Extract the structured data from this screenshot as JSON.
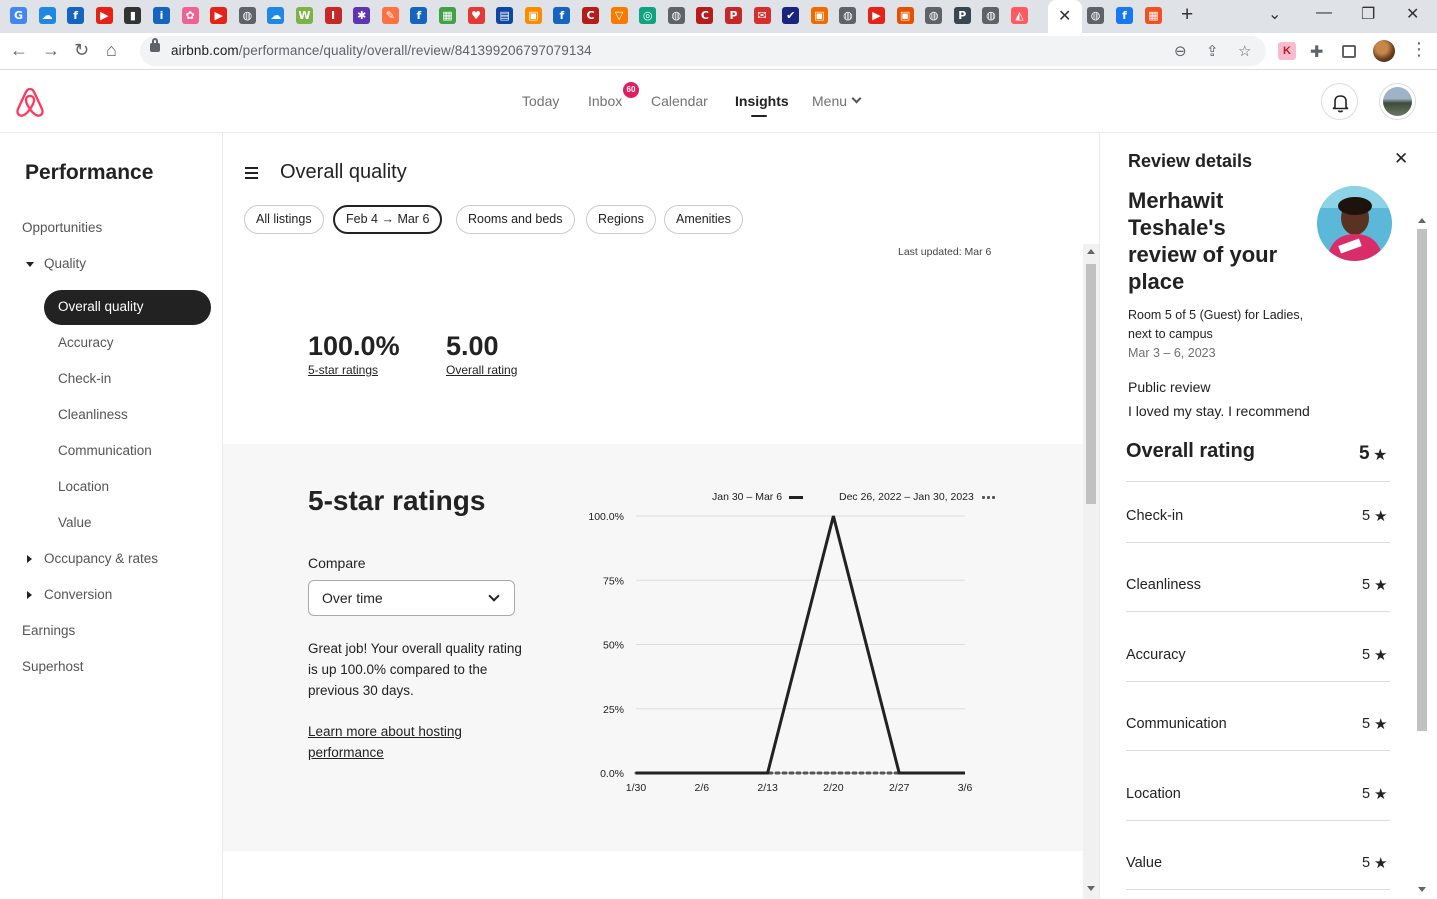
{
  "browser": {
    "tab_icons": [
      {
        "name": "google-icon",
        "color": "#4285f4",
        "glyph": "G"
      },
      {
        "name": "cloud-icon",
        "color": "#1e88e5",
        "glyph": "☁"
      },
      {
        "name": "info-icon",
        "color": "#1565c0",
        "glyph": "f"
      },
      {
        "name": "youtube-icon",
        "color": "#e62117",
        "glyph": "▶"
      },
      {
        "name": "app-icon",
        "color": "#333333",
        "glyph": "▮"
      },
      {
        "name": "info-box-icon",
        "color": "#1565c0",
        "glyph": "i"
      },
      {
        "name": "flower-icon",
        "color": "#f06292",
        "glyph": "✿"
      },
      {
        "name": "youtube-icon",
        "color": "#e62117",
        "glyph": "▶"
      },
      {
        "name": "globe-icon",
        "color": "#5f6368",
        "glyph": "◍"
      },
      {
        "name": "cloud-icon",
        "color": "#1e88e5",
        "glyph": "☁"
      },
      {
        "name": "w-icon",
        "color": "#7cb342",
        "glyph": "W"
      },
      {
        "name": "i-red-icon",
        "color": "#c62828",
        "glyph": "I"
      },
      {
        "name": "asterisk-icon",
        "color": "#5e35b1",
        "glyph": "✱"
      },
      {
        "name": "pen-icon",
        "color": "#ff7043",
        "glyph": "✎"
      },
      {
        "name": "info-icon",
        "color": "#1565c0",
        "glyph": "f"
      },
      {
        "name": "windows-icon",
        "color": "#43a047",
        "glyph": "▦"
      },
      {
        "name": "heart-icon",
        "color": "#e53935",
        "glyph": "♥"
      },
      {
        "name": "news-icon",
        "color": "#0d47a1",
        "glyph": "▤"
      },
      {
        "name": "box-icon",
        "color": "#fb8c00",
        "glyph": "▣"
      },
      {
        "name": "info-icon",
        "color": "#1565c0",
        "glyph": "f"
      },
      {
        "name": "c-icon",
        "color": "#b71c1c",
        "glyph": "C"
      },
      {
        "name": "funnel-icon",
        "color": "#f57c00",
        "glyph": "▽"
      },
      {
        "name": "chatgpt-icon",
        "color": "#10a37f",
        "glyph": "◎"
      },
      {
        "name": "globe-icon",
        "color": "#5f6368",
        "glyph": "◍"
      },
      {
        "name": "c-icon",
        "color": "#b71c1c",
        "glyph": "C"
      },
      {
        "name": "pd-icon",
        "color": "#c62828",
        "glyph": "P"
      },
      {
        "name": "mail-icon",
        "color": "#d32f2f",
        "glyph": "✉"
      },
      {
        "name": "check-icon",
        "color": "#1a237e",
        "glyph": "✔"
      },
      {
        "name": "box-icon",
        "color": "#ef6c00",
        "glyph": "▣"
      },
      {
        "name": "globe-icon",
        "color": "#5f6368",
        "glyph": "◍"
      },
      {
        "name": "youtube-icon",
        "color": "#e62117",
        "glyph": "▶"
      },
      {
        "name": "box-icon",
        "color": "#e65100",
        "glyph": "▣"
      },
      {
        "name": "globe-icon",
        "color": "#5f6368",
        "glyph": "◍"
      },
      {
        "name": "p-icon",
        "color": "#37474f",
        "glyph": "P"
      },
      {
        "name": "globe-icon",
        "color": "#5f6368",
        "glyph": "◍"
      },
      {
        "name": "airbnb-icon",
        "color": "#ff5a5f",
        "glyph": "◭"
      }
    ],
    "tab_icons_after": [
      {
        "name": "globe-icon",
        "color": "#5f6368",
        "glyph": "◍"
      },
      {
        "name": "facebook-icon",
        "color": "#1877f2",
        "glyph": "f"
      },
      {
        "name": "windows-icon",
        "color": "#f25022",
        "glyph": "▦"
      }
    ],
    "url_host": "airbnb.com",
    "url_path": "/performance/quality/overall/review/841399206797079134"
  },
  "header": {
    "nav": [
      "Today",
      "Inbox",
      "Calendar",
      "Insights",
      "Menu"
    ],
    "inbox_badge": "60",
    "active_nav": "Insights"
  },
  "sidebar": {
    "title": "Performance",
    "items": {
      "opportunities": "Opportunities",
      "quality": "Quality",
      "overall": "Overall quality",
      "accuracy": "Accuracy",
      "checkin": "Check-in",
      "cleanliness": "Cleanliness",
      "communication": "Communication",
      "location": "Location",
      "value": "Value",
      "occupancy": "Occupancy & rates",
      "conversion": "Conversion",
      "earnings": "Earnings",
      "superhost": "Superhost"
    }
  },
  "main": {
    "title": "Overall quality",
    "filters": {
      "all": "All listings",
      "date_from": "Feb 4",
      "date_to": "Mar 6",
      "rooms": "Rooms and beds",
      "regions": "Regions",
      "amenities": "Amenities"
    },
    "last_updated": "Last updated: Mar 6",
    "kpis": [
      {
        "value": "100.0%",
        "label": "5-star ratings"
      },
      {
        "value": "5.00",
        "label": "Overall rating"
      }
    ],
    "section_title": "5-star ratings",
    "compare_label": "Compare",
    "compare_value": "Over time",
    "blurb": "Great job! Your overall quality rating is up 100.0% compared to the previous 30 days.",
    "learn_more": "Learn more about hosting performance"
  },
  "chart_data": {
    "type": "line",
    "x": [
      "1/30",
      "2/6",
      "2/13",
      "2/20",
      "2/27",
      "3/6"
    ],
    "y_ticks": [
      "0.0%",
      "25%",
      "50%",
      "75%",
      "100.0%"
    ],
    "ylim": [
      0,
      100
    ],
    "grid": true,
    "series": [
      {
        "name": "Jan 30 – Mar 6",
        "style": "solid",
        "color": "#222222",
        "values": [
          0,
          0,
          0,
          100,
          0,
          0
        ]
      },
      {
        "name": "Dec 26, 2022 – Jan 30, 2023",
        "style": "dotted",
        "color": "#555555",
        "values": [
          0,
          0,
          0,
          0,
          0,
          0
        ]
      }
    ]
  },
  "panel": {
    "title": "Review details",
    "reviewer": "Merhawit Teshale's review of your place",
    "listing": "Room 5 of 5 (Guest) for Ladies, next to campus",
    "dates": "Mar 3 – 6, 2023",
    "public_review_heading": "Public review",
    "public_review_text": "I loved my stay. I recommend",
    "overall_label": "Overall rating",
    "overall_value": "5",
    "ratings": [
      {
        "label": "Check-in",
        "value": "5"
      },
      {
        "label": "Cleanliness",
        "value": "5"
      },
      {
        "label": "Accuracy",
        "value": "5"
      },
      {
        "label": "Communication",
        "value": "5"
      },
      {
        "label": "Location",
        "value": "5"
      },
      {
        "label": "Value",
        "value": "5"
      }
    ]
  },
  "colors": {
    "brand": "#ff385c",
    "badge": "#e31c5f",
    "ink": "#222222",
    "muted": "#717171"
  }
}
